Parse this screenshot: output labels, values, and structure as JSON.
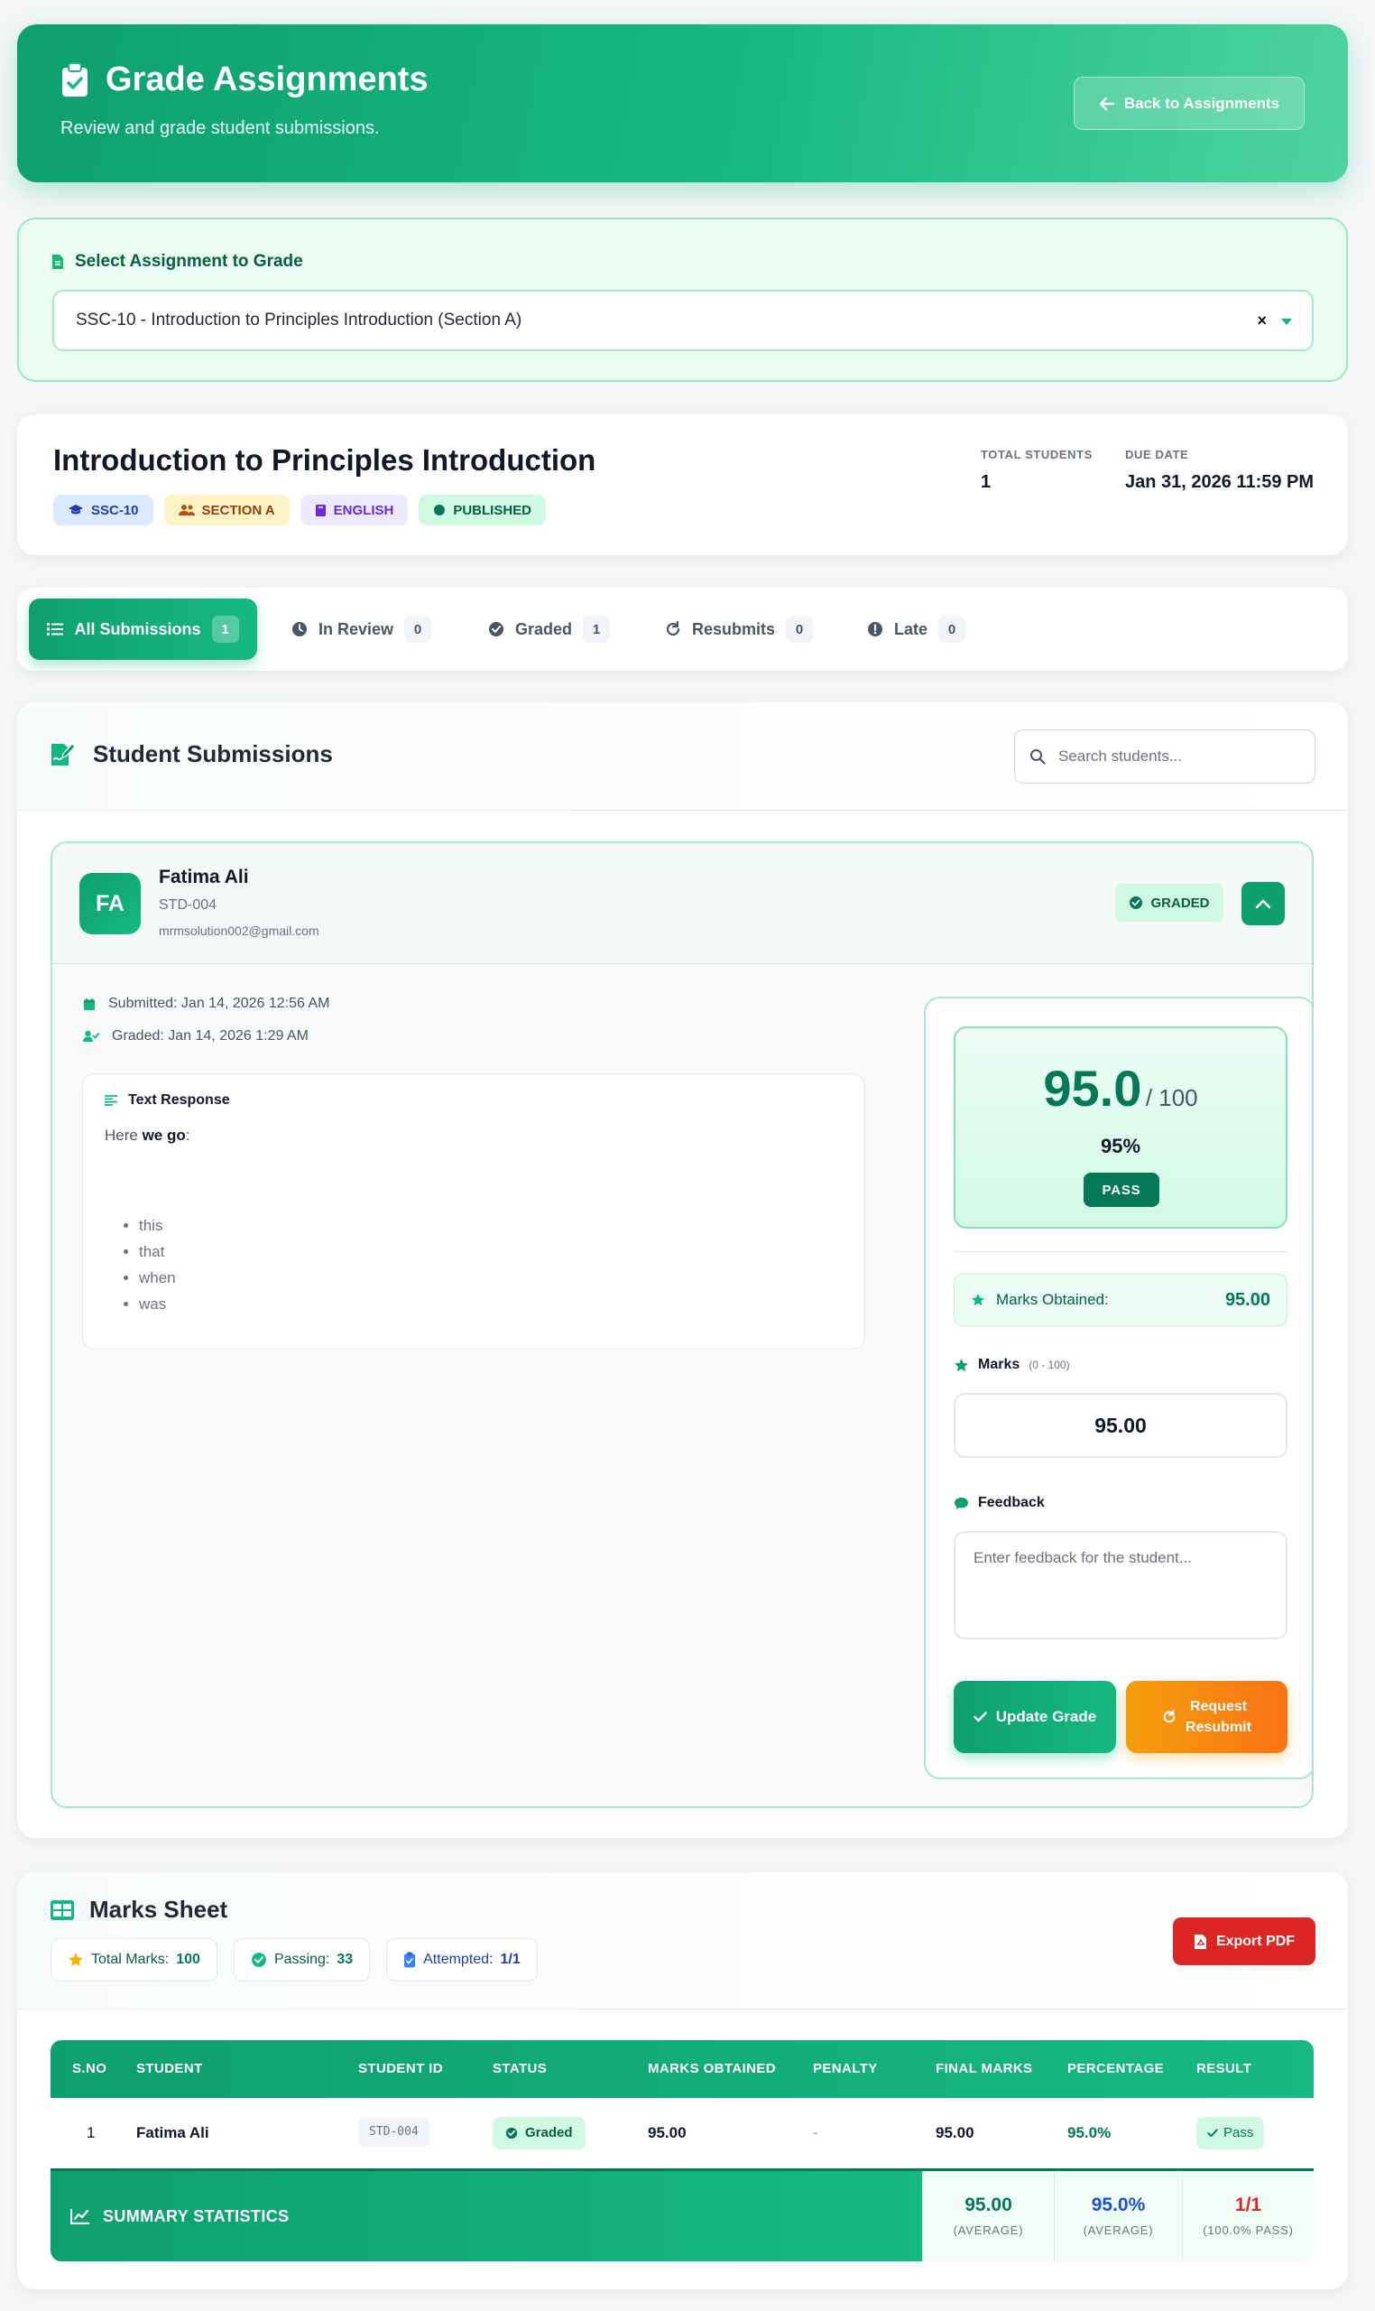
{
  "header": {
    "title": "Grade Assignments",
    "subtitle": "Review and grade student submissions.",
    "back_label": "Back to Assignments"
  },
  "assignment_select": {
    "label": "Select Assignment to Grade",
    "selected": "SSC-10 - Introduction to Principles Introduction (Section A)",
    "clear_symbol": "×"
  },
  "assignment": {
    "title": "Introduction to Principles Introduction",
    "badges": {
      "class": "SSC-10",
      "section": "SECTION A",
      "subject": "ENGLISH",
      "status": "PUBLISHED"
    },
    "total_students_label": "TOTAL STUDENTS",
    "total_students": "1",
    "due_date_label": "DUE DATE",
    "due_date": "Jan 31, 2026 11:59 PM"
  },
  "tabs": [
    {
      "label": "All Submissions",
      "count": "1"
    },
    {
      "label": "In Review",
      "count": "0"
    },
    {
      "label": "Graded",
      "count": "1"
    },
    {
      "label": "Resubmits",
      "count": "0"
    },
    {
      "label": "Late",
      "count": "0"
    }
  ],
  "submissions": {
    "title": "Student Submissions",
    "search_placeholder": "Search students...",
    "student": {
      "initials": "FA",
      "name": "Fatima Ali",
      "id": "STD-004",
      "email": "mrmsolution002@gmail.com",
      "status": "GRADED",
      "submitted": "Submitted: Jan 14, 2026 12:56 AM",
      "graded": "Graded: Jan 14, 2026 1:29 AM",
      "response_title": "Text Response",
      "response_prefix": "Here ",
      "response_bold": "we go",
      "response_suffix": ":",
      "response_items": [
        "this",
        "that",
        "when",
        "was"
      ]
    },
    "grade": {
      "score": "95.0",
      "out_of": "/ 100",
      "percent": "95%",
      "result": "PASS",
      "marks_obtained_label": "Marks Obtained:",
      "marks_obtained": "95.00",
      "marks_label": "Marks",
      "marks_range": "(0 - 100)",
      "marks_value": "95.00",
      "feedback_label": "Feedback",
      "feedback_placeholder": "Enter feedback for the student...",
      "update_label": "Update Grade",
      "resubmit_line1": "Request",
      "resubmit_line2": "Resubmit"
    }
  },
  "marks_sheet": {
    "title": "Marks Sheet",
    "total_marks_label": "Total Marks:",
    "total_marks": "100",
    "passing_label": "Passing:",
    "passing": "33",
    "attempted_label": "Attempted:",
    "attempted": "1/1",
    "export_label": "Export PDF",
    "columns": [
      "S.NO",
      "STUDENT",
      "STUDENT ID",
      "STATUS",
      "MARKS OBTAINED",
      "PENALTY",
      "FINAL MARKS",
      "PERCENTAGE",
      "RESULT"
    ],
    "rows": [
      {
        "sno": "1",
        "student": "Fatima Ali",
        "student_id": "STD-004",
        "status": "Graded",
        "marks": "95.00",
        "penalty": "-",
        "final": "95.00",
        "percentage": "95.0%",
        "result": "Pass"
      }
    ],
    "summary": {
      "label": "SUMMARY STATISTICS",
      "avg_marks": "95.00",
      "avg_marks_label": "(AVERAGE)",
      "avg_pct": "95.0%",
      "avg_pct_label": "(AVERAGE)",
      "pass_ratio": "1/1",
      "pass_ratio_label": "(100.0% PASS)"
    }
  },
  "colors": {
    "primary": "#10b981",
    "primary_dark": "#0e9f6e",
    "warning": "#f59e0b",
    "danger": "#dc2626",
    "pass_red": "#dc2626"
  }
}
